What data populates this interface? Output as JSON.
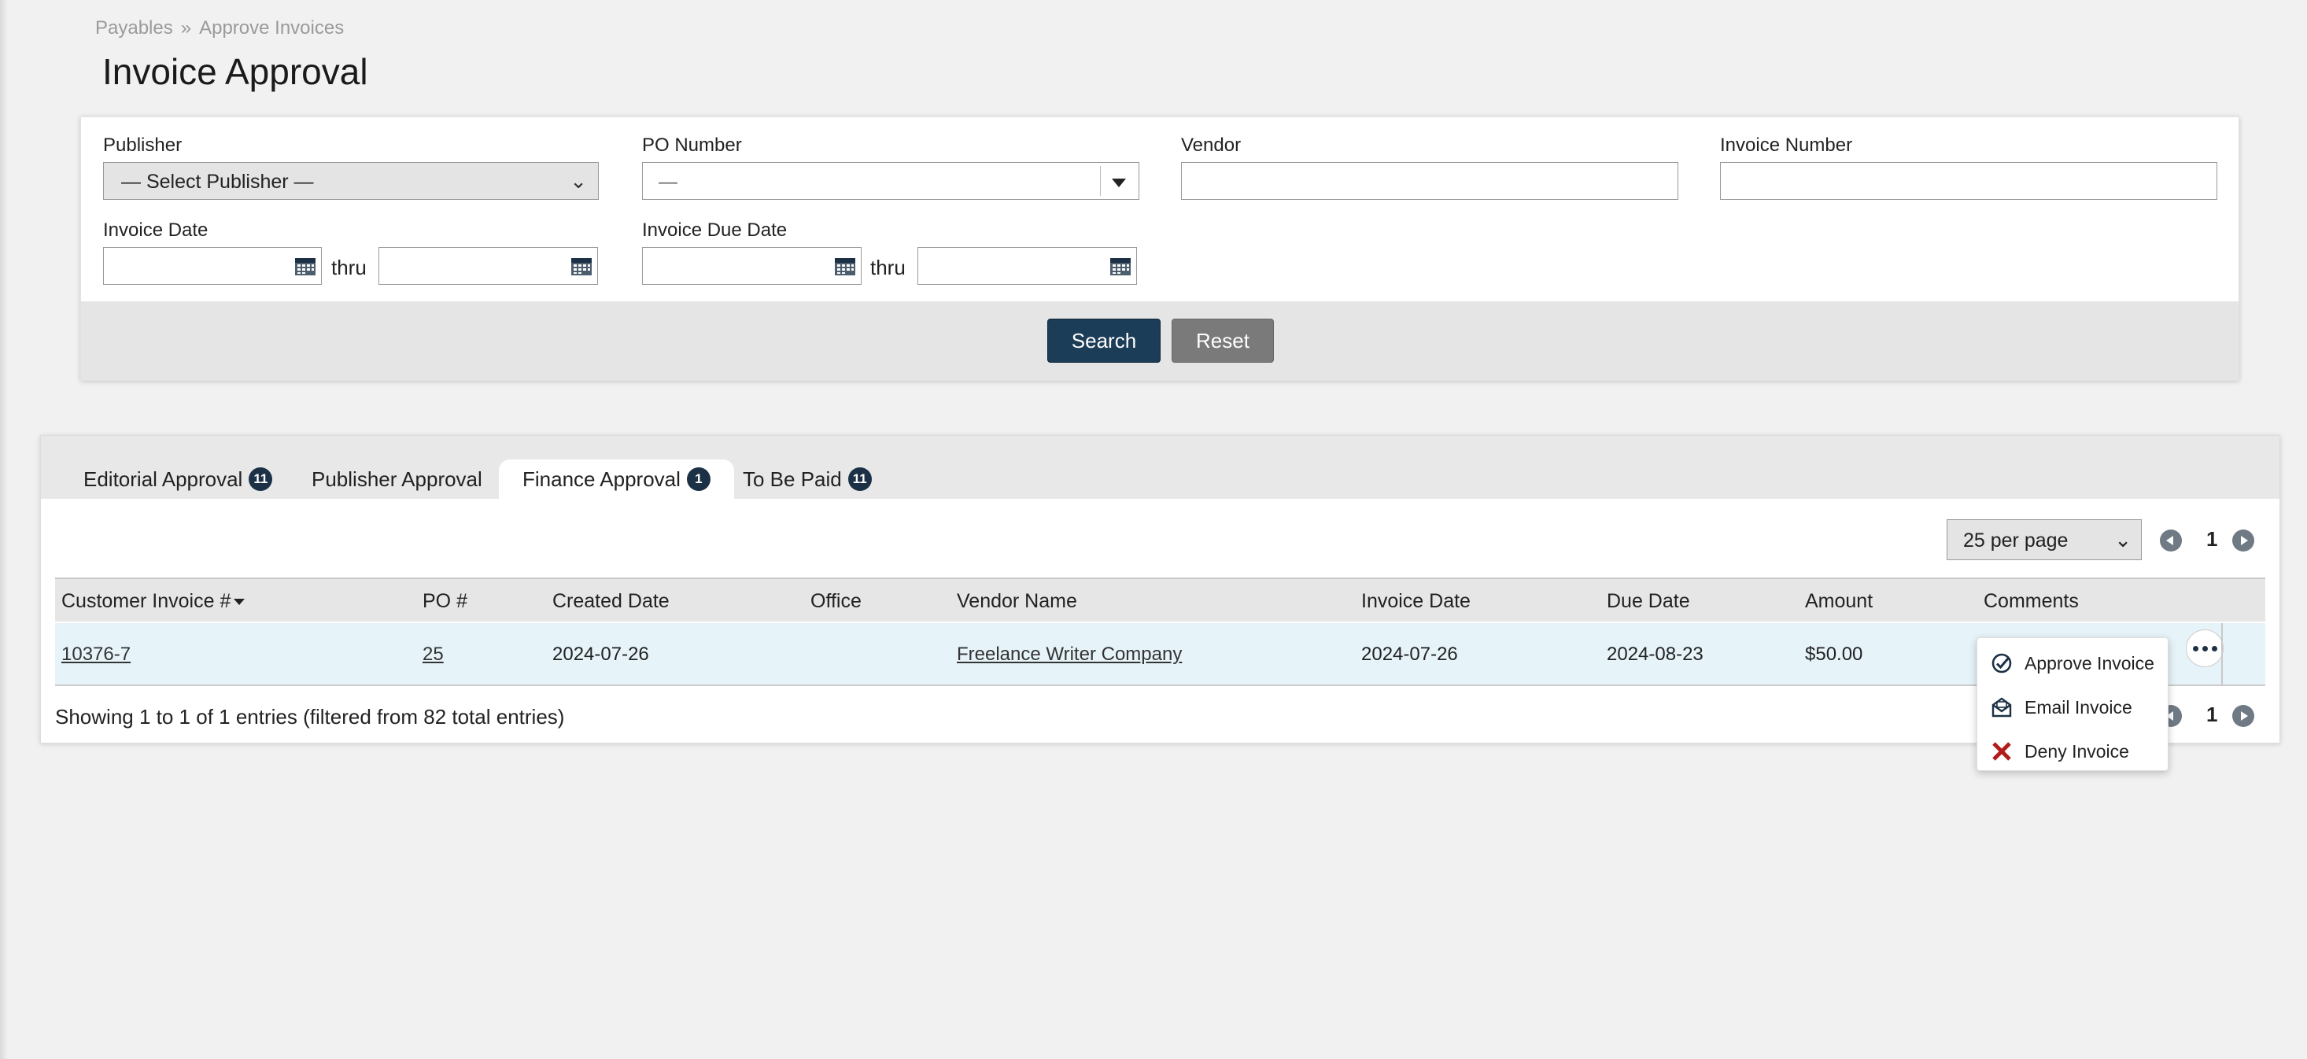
{
  "breadcrumb": {
    "parent": "Payables",
    "separator": "»",
    "current": "Approve Invoices"
  },
  "page": {
    "title": "Invoice Approval"
  },
  "filters": {
    "publisher": {
      "label": "Publisher",
      "value": "— Select Publisher —"
    },
    "po_number": {
      "label": "PO Number",
      "value": "—"
    },
    "vendor": {
      "label": "Vendor",
      "value": ""
    },
    "invoice_number": {
      "label": "Invoice Number",
      "value": ""
    },
    "invoice_date": {
      "label": "Invoice Date",
      "thru": "thru"
    },
    "invoice_due_date": {
      "label": "Invoice Due Date",
      "thru": "thru"
    },
    "search_label": "Search",
    "reset_label": "Reset"
  },
  "tabs": [
    {
      "label": "Editorial Approval",
      "badge": "11"
    },
    {
      "label": "Publisher Approval"
    },
    {
      "label": "Finance Approval",
      "badge": "1",
      "active": true
    },
    {
      "label": "To Be Paid",
      "badge": "11"
    }
  ],
  "pagination": {
    "per_page": "25 per page",
    "page": "1"
  },
  "table": {
    "columns": [
      "Customer Invoice #",
      "PO #",
      "Created Date",
      "Office",
      "Vendor Name",
      "Invoice Date",
      "Due Date",
      "Amount",
      "Comments"
    ],
    "rows": [
      {
        "customer_invoice": "10376-7",
        "po": "25",
        "created_date": "2024-07-26",
        "office": "",
        "vendor_name": "Freelance Writer Company",
        "invoice_date": "2024-07-26",
        "due_date": "2024-08-23",
        "amount": "$50.00",
        "comments": ""
      }
    ]
  },
  "summary": "Showing 1 to 1 of 1 entries (filtered from 82 total entries)",
  "row_menu": {
    "items": [
      {
        "label": "Approve Invoice",
        "icon": "check-circle-icon"
      },
      {
        "label": "Email Invoice",
        "icon": "envelope-open-icon"
      },
      {
        "label": "Deny Invoice",
        "icon": "x-icon",
        "color": "#b31b1b"
      }
    ]
  },
  "colors": {
    "primary": "#1c3d58",
    "badge": "#1c3146",
    "row_highlight": "#e6f3f9",
    "danger": "#b31b1b"
  }
}
